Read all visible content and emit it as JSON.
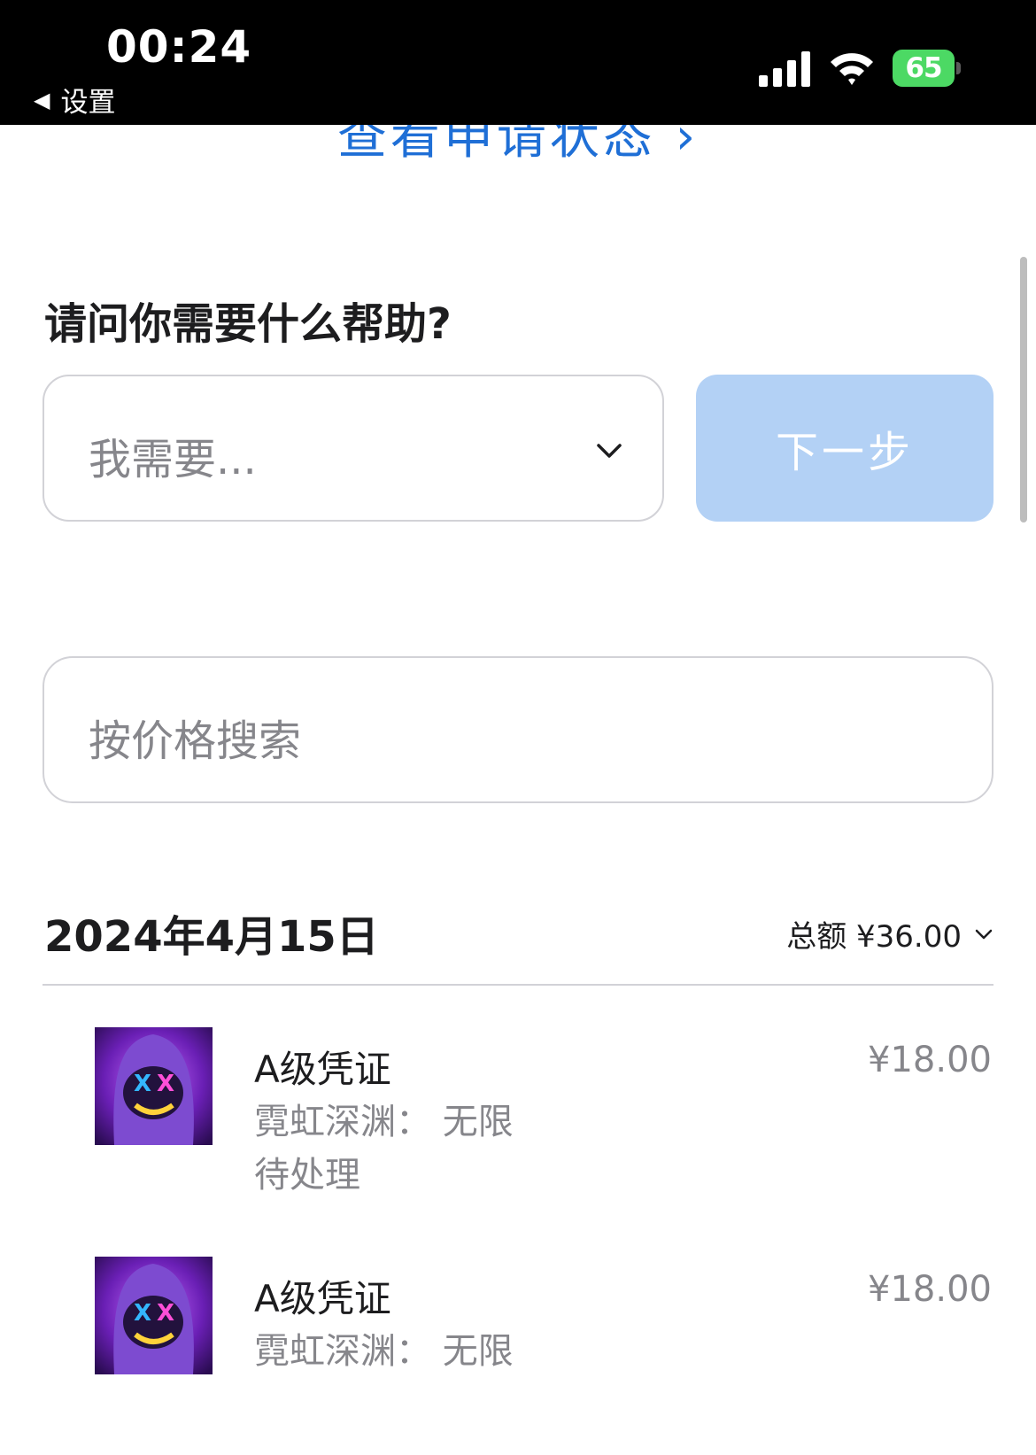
{
  "status_bar": {
    "time": "00:24",
    "back_app_label": "设置",
    "battery_level": "65",
    "signal_icon": "cellular-signal-icon",
    "wifi_icon": "wifi-icon",
    "battery_icon": "battery-charging-icon"
  },
  "links": {
    "application_status": "查看申请状态 ›"
  },
  "help": {
    "heading": "请问你需要什么帮助?",
    "select_placeholder": "我需要...",
    "next_label": "下一步"
  },
  "search": {
    "placeholder": "按价格搜索"
  },
  "orders": {
    "date": "2024年4月15日",
    "total_label": "总额 ¥36.00",
    "items": [
      {
        "title": "A级凭证",
        "subtitle": "霓虹深渊：  无限",
        "status": "待处理",
        "price": "¥18.00"
      },
      {
        "title": "A级凭证",
        "subtitle": "霓虹深渊：  无限",
        "price": "¥18.00"
      }
    ]
  },
  "colors": {
    "accent": "#1f6fd6",
    "disabled_button": "#b3d1f5",
    "secondary_text": "#86868b",
    "battery": "#4cd964"
  }
}
